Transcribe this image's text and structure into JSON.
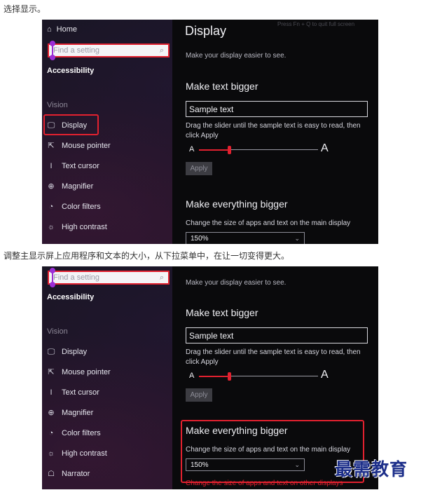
{
  "captions": {
    "first": "选择显示。",
    "second": "调整主显示屏上应用程序和文本的大小，从下拉菜单中，在让一切变得更大。"
  },
  "sidebar": {
    "home_label": "Home",
    "home_icon": "home-icon",
    "search_placeholder": "Find a setting",
    "search_icon": "search-icon",
    "section_title": "Accessibility",
    "group_title": "Vision",
    "items": [
      {
        "label": "Display",
        "icon": "monitor-icon"
      },
      {
        "label": "Mouse pointer",
        "icon": "mouse-pointer-icon"
      },
      {
        "label": "Text cursor",
        "icon": "text-cursor-icon"
      },
      {
        "label": "Magnifier",
        "icon": "magnifier-icon"
      },
      {
        "label": "Color filters",
        "icon": "color-filters-icon"
      },
      {
        "label": "High contrast",
        "icon": "high-contrast-icon"
      },
      {
        "label": "Narrator",
        "icon": "narrator-icon"
      }
    ]
  },
  "display_pane": {
    "title": "Display",
    "watermark": "Press Fn + Q to quit full screen",
    "subtitle": "Make your display easier to see.",
    "text_bigger_heading": "Make text bigger",
    "sample_text": "Sample text",
    "slider_description": "Drag the slider until the sample text is easy to read, then click Apply",
    "slider_min_label": "A",
    "slider_max_label": "A",
    "slider_level": 0.25,
    "apply_label": "Apply",
    "everything_bigger_heading": "Make everything bigger",
    "everything_description": "Change the size of apps and text on the main display",
    "scale_value": "150%",
    "other_displays_link": "Change the size of apps and text on other displays"
  },
  "logo_text": "最需教育",
  "colors": {
    "highlight_red": "#e2212f",
    "cursor_purple": "#9b2fd6",
    "logo_blue": "#1d2f8a"
  }
}
